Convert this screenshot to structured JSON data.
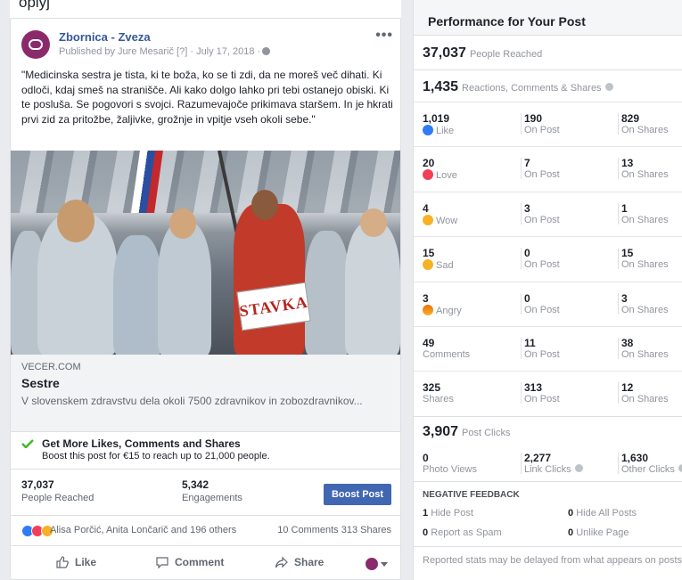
{
  "post": {
    "top_cropped_text": "oplyj",
    "page_name": "Zbornica - Zveza",
    "published_by": "Published by Jure Mesarič [?] · July 17, 2018 ·",
    "more_label": "•••",
    "text": "\"Medicinska sestra je tista, ki te boža, ko se ti zdi, da ne moreš več dihati. Ki odloči, kdaj smeš na stranišče. Ali kako dolgo lahko pri tebi ostanejo obiski. Ki te posluša. Se pogovori s svojci. Razumevajoče prikimava staršem. In je hkrati prvi zid za pritožbe, žaljivke, grožnje in vpitje vseh okoli sebe.\"",
    "image_sign_text": "STAVKA",
    "link": {
      "domain": "VECER.COM",
      "title": "Sestre",
      "description": "V slovenskem zdravstvu dela okoli 7500 zdravnikov in zobozdravnikov..."
    },
    "promo": {
      "title": "Get More Likes, Comments and Shares",
      "subtitle": "Boost this post for €15 to reach up to 21,000 people."
    },
    "stats": {
      "reached_num": "37,037",
      "reached_label": "People Reached",
      "engagements_num": "5,342",
      "engagements_label": "Engagements",
      "boost_button": "Boost Post"
    },
    "reactions": {
      "names": "Alisa Porčić, Anita Lončarič and 196 others",
      "comments_shares": "10 Comments  313 Shares"
    },
    "actions": {
      "like": "Like",
      "comment": "Comment",
      "share": "Share"
    }
  },
  "panel": {
    "title": "Performance for Your Post",
    "reached_num": "37,037",
    "reached_label": "People Reached",
    "reactions_num": "1,435",
    "reactions_label": "Reactions, Comments & Shares",
    "rows": [
      {
        "n1": "1,019",
        "l1": "Like",
        "n2": "190",
        "l2": "On Post",
        "n3": "829",
        "l3": "On Shares",
        "icon": "like"
      },
      {
        "n1": "20",
        "l1": "Love",
        "n2": "7",
        "l2": "On Post",
        "n3": "13",
        "l3": "On Shares",
        "icon": "love"
      },
      {
        "n1": "4",
        "l1": "Wow",
        "n2": "3",
        "l2": "On Post",
        "n3": "1",
        "l3": "On Shares",
        "icon": "wow"
      },
      {
        "n1": "15",
        "l1": "Sad",
        "n2": "0",
        "l2": "On Post",
        "n3": "15",
        "l3": "On Shares",
        "icon": "sad"
      },
      {
        "n1": "3",
        "l1": "Angry",
        "n2": "0",
        "l2": "On Post",
        "n3": "3",
        "l3": "On Shares",
        "icon": "angry"
      },
      {
        "n1": "49",
        "l1": "Comments",
        "n2": "11",
        "l2": "On Post",
        "n3": "38",
        "l3": "On Shares",
        "icon": ""
      },
      {
        "n1": "325",
        "l1": "Shares",
        "n2": "313",
        "l2": "On Post",
        "n3": "12",
        "l3": "On Shares",
        "icon": ""
      }
    ],
    "clicks_num": "3,907",
    "clicks_label": "Post Clicks",
    "clicks": {
      "n1": "0",
      "l1": "Photo Views",
      "n2": "2,277",
      "l2": "Link Clicks",
      "n3": "1,630",
      "l3": "Other Clicks"
    },
    "negative_head": "NEGATIVE FEEDBACK",
    "negative": [
      {
        "num": "1",
        "label": "Hide Post"
      },
      {
        "num": "0",
        "label": "Hide All Posts"
      },
      {
        "num": "0",
        "label": "Report as Spam"
      },
      {
        "num": "0",
        "label": "Unlike Page"
      }
    ],
    "footer": "Reported stats may be delayed from what appears on posts"
  },
  "colors": {
    "link_blue": "#365899",
    "boost_button": "#4267b2",
    "like": "#2e7cf6",
    "love": "#f33e58",
    "wow": "#f7b125"
  }
}
